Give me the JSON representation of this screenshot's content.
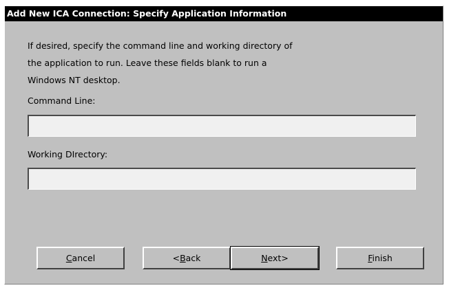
{
  "window": {
    "title": "Add New ICA Connection: Specify Application Information"
  },
  "description": {
    "lines": [
      "If desired, specify the command line and working directory of",
      "the application to run. Leave these fields blank to run a",
      "Windows NT desktop."
    ]
  },
  "command_line": {
    "label": "Command Line:",
    "value": ""
  },
  "working_directory": {
    "label": "Working DIrectory:",
    "value": ""
  },
  "buttons": {
    "cancel": {
      "mnemonic": "C",
      "rest": "ancel"
    },
    "back": {
      "prefix": "<",
      "mnemonic": "B",
      "rest": "ack"
    },
    "next": {
      "mnemonic": "N",
      "rest": "ext>"
    },
    "finish": {
      "mnemonic": "F",
      "rest": "inish"
    }
  },
  "colors": {
    "dialog_background": "#c0c0c0",
    "titlebar_background": "#000000",
    "titlebar_text": "#ffffff",
    "field_background": "#f0f0f0"
  }
}
